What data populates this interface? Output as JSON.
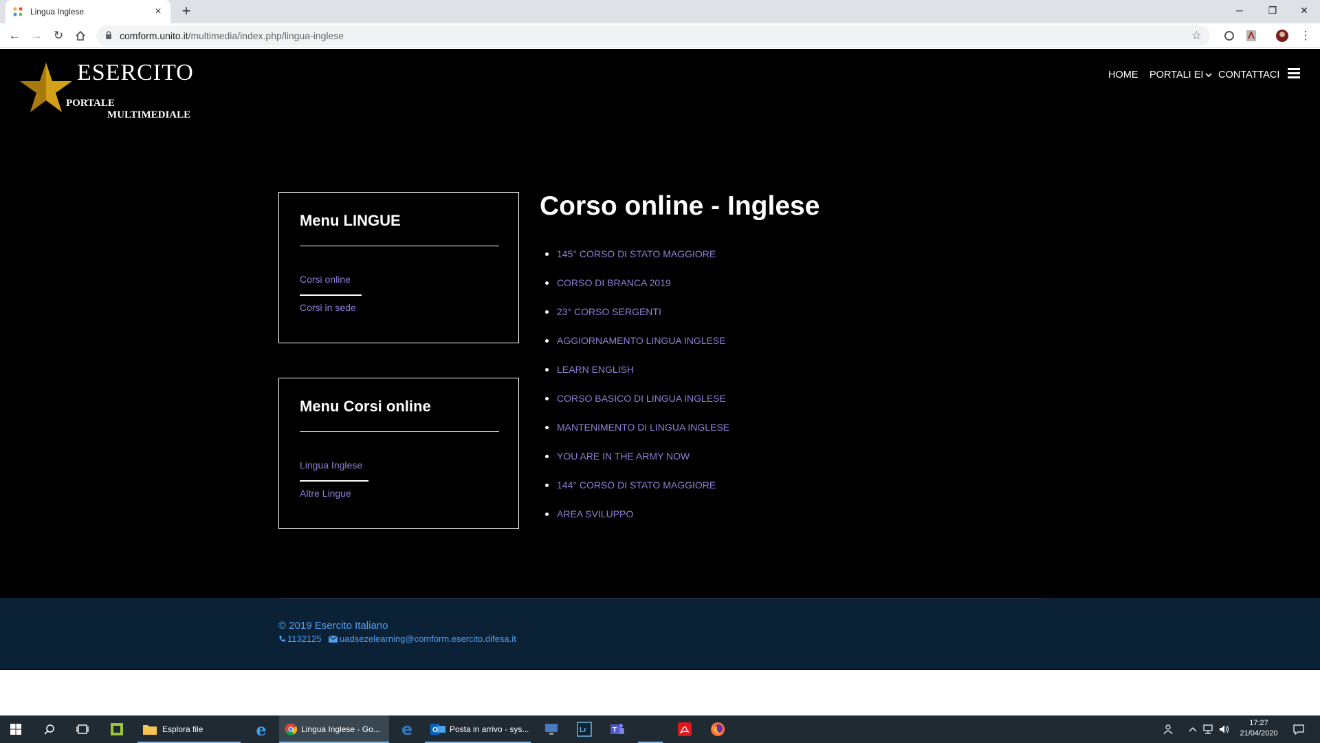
{
  "browser": {
    "tab_title": "Lingua Inglese",
    "new_tab": "+",
    "url_host": "comform.unito.it",
    "url_path": "/multimedia/index.php/lingua-inglese"
  },
  "site": {
    "logo_main": "ESERCITO",
    "logo_sub1": "PORTALE",
    "logo_sub2": "MULTIMEDIALE",
    "nav": {
      "home": "HOME",
      "portali": "PORTALI EI",
      "contattaci": "CONTATTACI"
    }
  },
  "menu_lingue": {
    "title": "Menu LINGUE",
    "items": [
      "Corsi online",
      "Corsi in sede"
    ]
  },
  "menu_corsi": {
    "title": "Menu Corsi online",
    "items": [
      "Lingua Inglese",
      "Altre Lingue"
    ]
  },
  "content": {
    "title": "Corso online - Inglese",
    "courses": [
      "145° CORSO DI STATO MAGGIORE",
      "CORSO DI BRANCA 2019",
      "23° CORSO SERGENTI",
      "AGGIORNAMENTO LINGUA INGLESE",
      "LEARN ENGLISH",
      "CORSO BASICO DI LINGUA INGLESE",
      "MANTENIMENTO DI LINGUA INGLESE",
      "YOU ARE IN THE ARMY NOW",
      "144° CORSO DI STATO MAGGIORE",
      "AREA SVILUPPO"
    ]
  },
  "footer": {
    "copyright": "© 2019 Esercito Italiano",
    "phone": "1132125",
    "email": "uadsezelearning@comform.esercito.difesa.it"
  },
  "taskbar": {
    "explorer_label": "Esplora file",
    "chrome_label": "Lingua Inglese - Go...",
    "outlook_label": "Posta in arrivo - sys...",
    "time": "17:27",
    "date": "21/04/2020"
  },
  "colors": {
    "link": "#8f7fd8",
    "footer_bg": "#0b2135",
    "footer_text": "#4f9ef2",
    "star": "#d4a017"
  }
}
